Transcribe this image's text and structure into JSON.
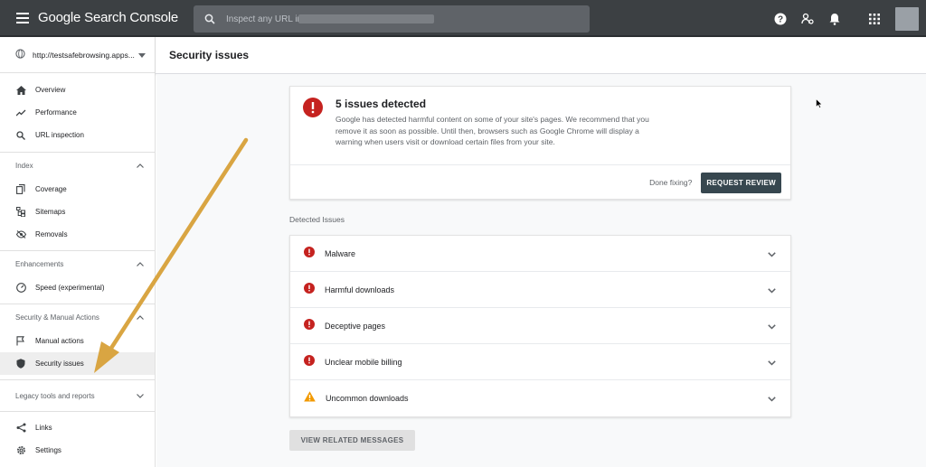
{
  "app": {
    "title": "Google Search Console"
  },
  "search": {
    "placeholder": "Inspect any URL in \""
  },
  "property": {
    "label": "http://testsafebrowsing.apps..."
  },
  "sidebar": {
    "top_items": [
      {
        "label": "Overview",
        "icon": "home-icon"
      },
      {
        "label": "Performance",
        "icon": "trending-up-icon"
      },
      {
        "label": "URL inspection",
        "icon": "search-icon"
      }
    ],
    "sections": [
      {
        "title": "Index",
        "items": [
          {
            "label": "Coverage",
            "icon": "copy-icon"
          },
          {
            "label": "Sitemaps",
            "icon": "sitemap-icon"
          },
          {
            "label": "Removals",
            "icon": "eye-off-icon"
          }
        ]
      },
      {
        "title": "Enhancements",
        "items": [
          {
            "label": "Speed (experimental)",
            "icon": "speedometer-icon"
          }
        ]
      },
      {
        "title": "Security & Manual Actions",
        "items": [
          {
            "label": "Manual actions",
            "icon": "flag-icon"
          },
          {
            "label": "Security issues",
            "icon": "shield-icon",
            "active": true
          }
        ]
      },
      {
        "title": "Legacy tools and reports",
        "items": []
      }
    ],
    "bottom_items": [
      {
        "label": "Links",
        "icon": "links-icon"
      },
      {
        "label": "Settings",
        "icon": "gear-icon"
      }
    ]
  },
  "page": {
    "title": "Security issues"
  },
  "alert": {
    "title": "5 issues detected",
    "description": "Google has detected harmful content on some of your site's pages. We recommend that you remove it as soon as possible. Until then, browsers such as Google Chrome will display a warning when users visit or download certain files from your site.",
    "done_text": "Done fixing?",
    "review_button": "REQUEST REVIEW"
  },
  "detected": {
    "label": "Detected Issues",
    "issues": [
      {
        "label": "Malware",
        "severity": "error"
      },
      {
        "label": "Harmful downloads",
        "severity": "error"
      },
      {
        "label": "Deceptive pages",
        "severity": "error"
      },
      {
        "label": "Unclear mobile billing",
        "severity": "error"
      },
      {
        "label": "Uncommon downloads",
        "severity": "warning"
      }
    ]
  },
  "related_button": "VIEW RELATED MESSAGES",
  "colors": {
    "error": "#c5221f",
    "warning": "#f29900",
    "topbar": "#3c4043",
    "annotation_arrow": "#d9a542"
  }
}
